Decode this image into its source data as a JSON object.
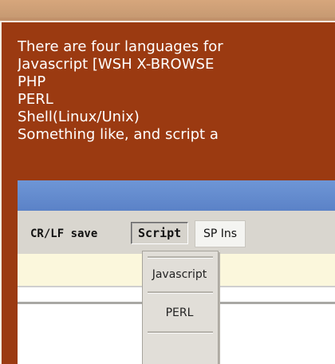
{
  "description_lines": [
    "There are four languages for",
    "Javascript [WSH X-BROWSE",
    "PHP",
    "PERL",
    "Shell(Linux/Unix)",
    "Something like, and script a"
  ],
  "toolbar": {
    "crlf_label": "CR/LF save",
    "script_label": "Script",
    "sp_label": "SP Ins"
  },
  "script_menu": {
    "items": [
      "Javascript",
      "PERL"
    ]
  },
  "colors": {
    "panel_bg": "#9b3a11",
    "page_bg": "#c2926b",
    "window_title": "#5b82c7",
    "toolbar_bg": "#d9d6cf",
    "editor_bg": "#fbf7dc"
  }
}
